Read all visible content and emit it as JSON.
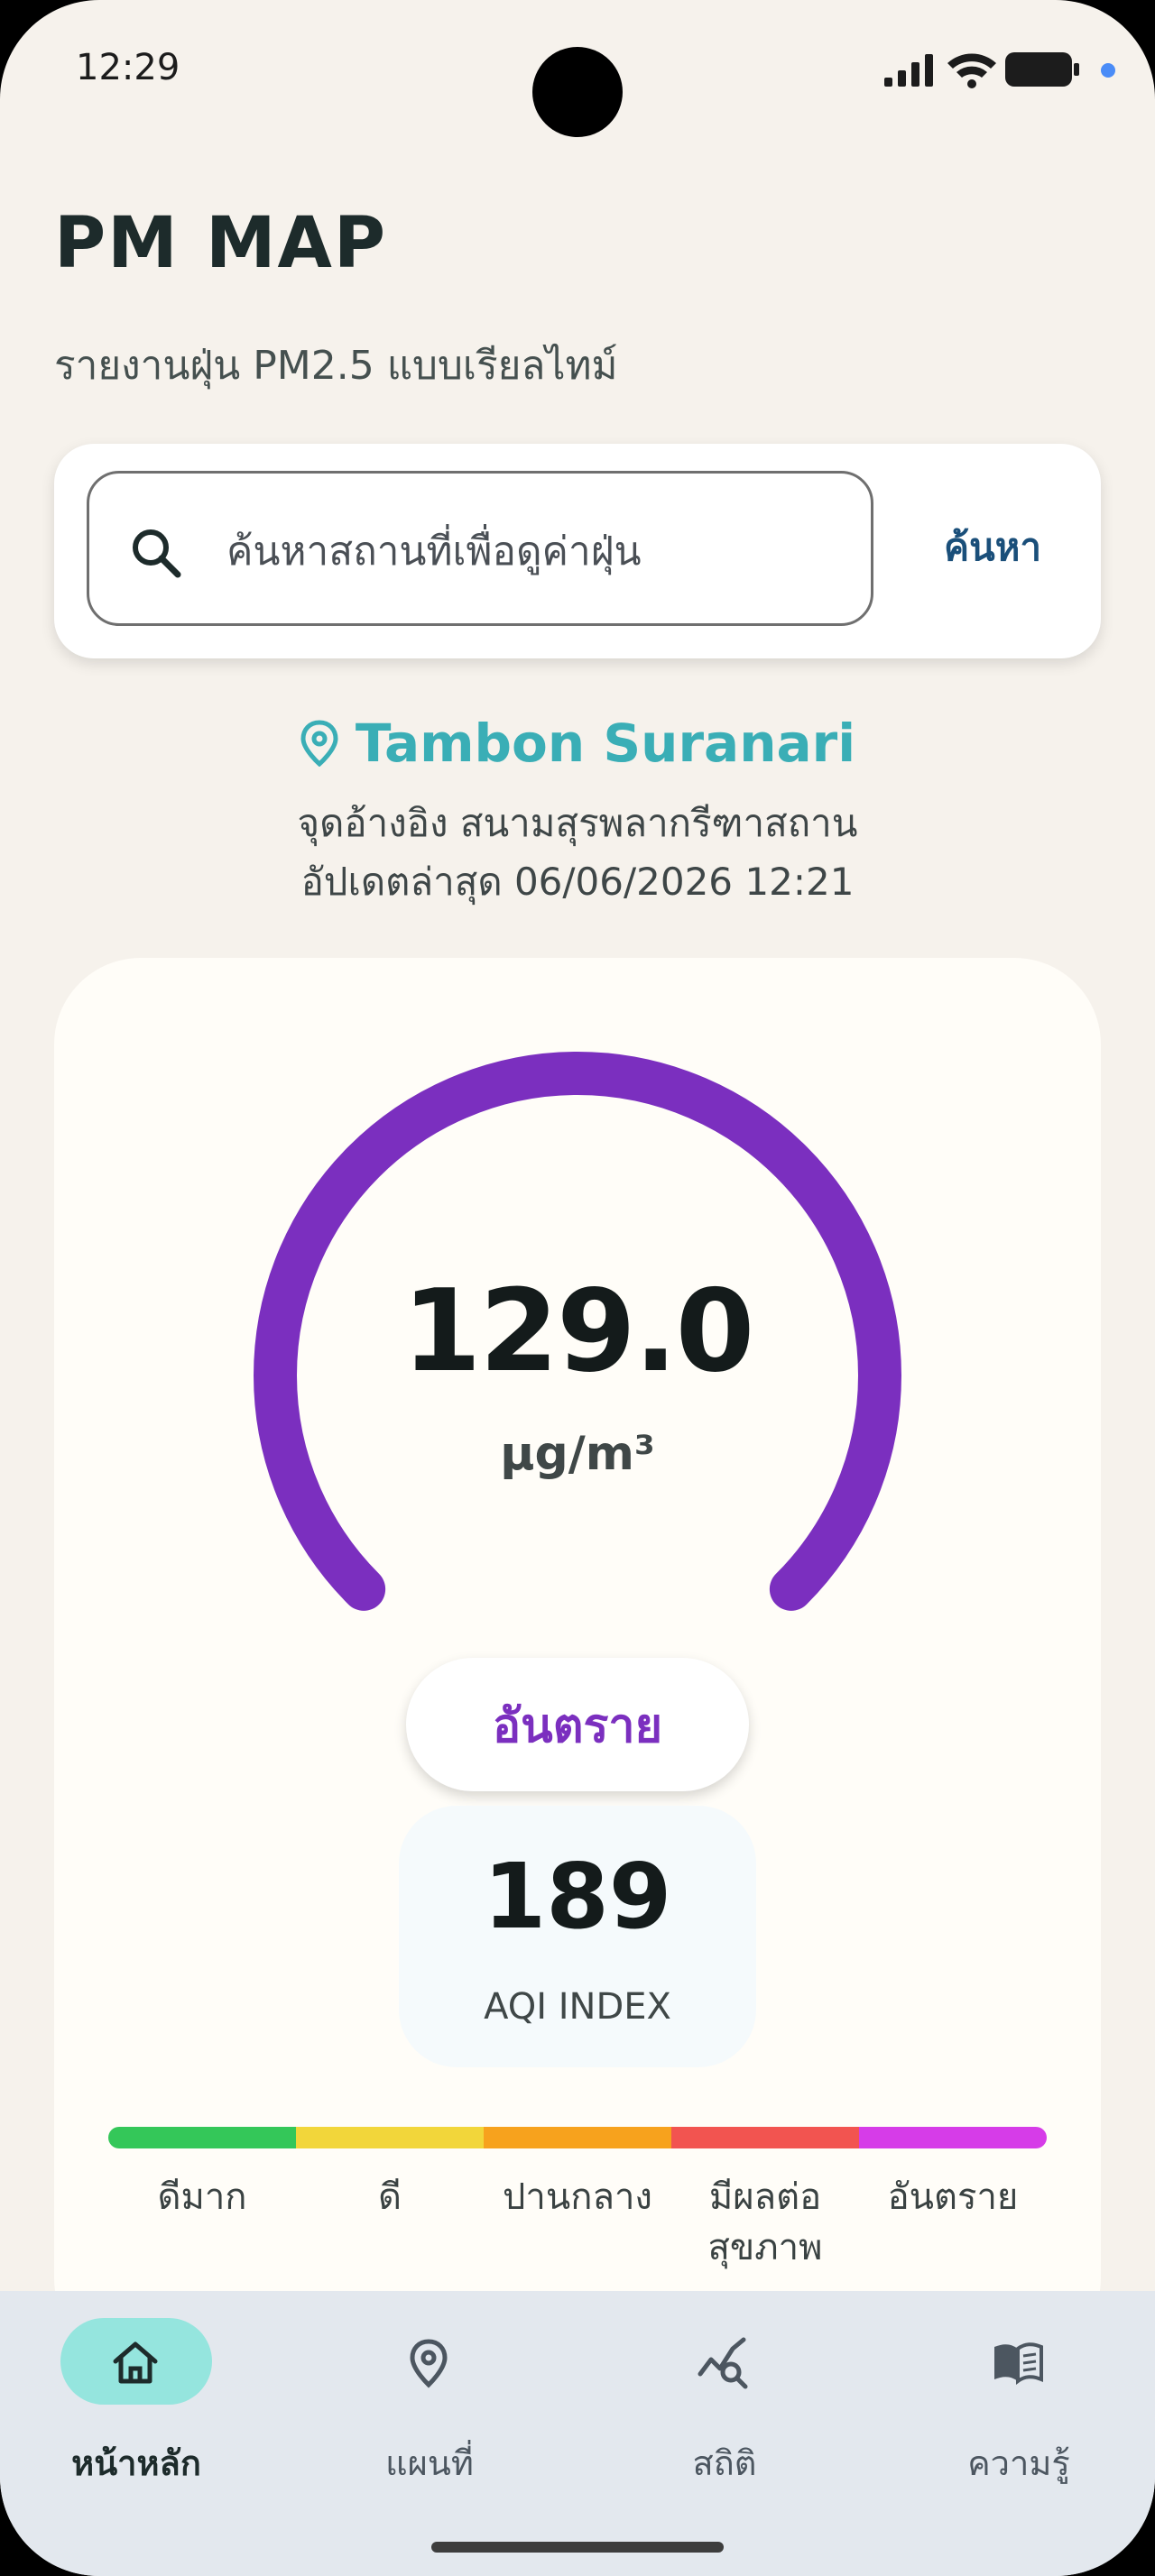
{
  "status": {
    "time": "12:29"
  },
  "header": {
    "title": "PM MAP",
    "subtitle": "รายงานฝุ่น PM2.5 แบบเรียลไทม์"
  },
  "search": {
    "placeholder": "ค้นหาสถานที่เพื่อดูค่าฝุ่น",
    "button_label": "ค้นหา"
  },
  "location": {
    "name": "Tambon Suranari",
    "reference": "จุดอ้างอิง สนามสุรพลากรีฑาสถาน",
    "updated": "อัปเดตล่าสุด 06/06/2026 12:21"
  },
  "reading": {
    "value": "129.0",
    "unit": "µg/m³",
    "level": "อันตราย",
    "aqi_value": "189",
    "aqi_label": "AQI INDEX",
    "gauge_fraction": 1.0
  },
  "scale": [
    {
      "label": "ดีมาก",
      "color": "#34c759"
    },
    {
      "label": "ดี",
      "color": "#f2d63a"
    },
    {
      "label": "ปานกลาง",
      "color": "#f7a21d"
    },
    {
      "label": "มีผลต่อ\nสุขภาพ",
      "color": "#f25450"
    },
    {
      "label": "อันตราย",
      "color": "#d63ce8"
    }
  ],
  "colors": {
    "gauge": "#7b2fbf",
    "accent": "#3aaeb6",
    "nav_active": "#95e5de"
  },
  "nav": [
    {
      "label": "หน้าหลัก",
      "icon": "home-icon",
      "active": true
    },
    {
      "label": "แผนที่",
      "icon": "map-pin-icon",
      "active": false
    },
    {
      "label": "สถิติ",
      "icon": "chart-search-icon",
      "active": false
    },
    {
      "label": "ความรู้",
      "icon": "book-icon",
      "active": false
    }
  ]
}
